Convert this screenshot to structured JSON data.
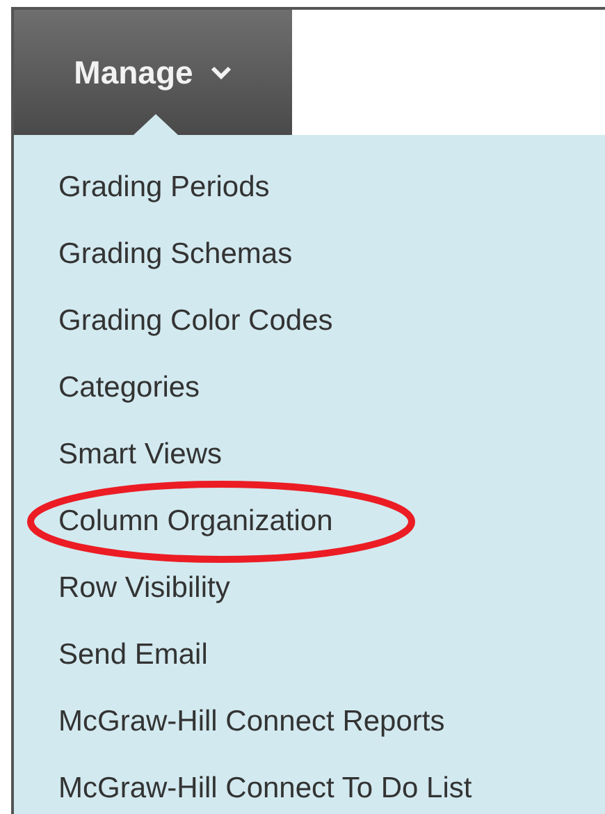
{
  "menu_button": {
    "label": "Manage"
  },
  "menu_items": [
    {
      "label": "Grading Periods",
      "circled": false
    },
    {
      "label": "Grading Schemas",
      "circled": false
    },
    {
      "label": "Grading Color Codes",
      "circled": false
    },
    {
      "label": "Categories",
      "circled": false
    },
    {
      "label": "Smart Views",
      "circled": false
    },
    {
      "label": "Column Organization",
      "circled": true
    },
    {
      "label": "Row Visibility",
      "circled": false
    },
    {
      "label": "Send Email",
      "circled": false
    },
    {
      "label": "McGraw-Hill Connect Reports",
      "circled": false
    },
    {
      "label": "McGraw-Hill Connect To Do List",
      "circled": false
    }
  ]
}
